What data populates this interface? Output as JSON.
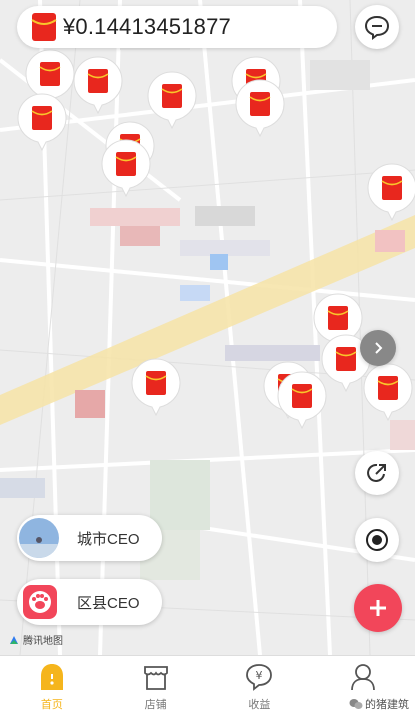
{
  "balance": {
    "currency": "¥",
    "amount": "0.14413451877",
    "text": "¥0.14413451877"
  },
  "buttons": {
    "message_icon": "chat-bubble-icon",
    "share_icon": "share-arrow-icon",
    "locate_icon": "locate-icon",
    "add_icon": "plus-icon",
    "arrow_icon": "chevron-right-icon"
  },
  "ceo": [
    {
      "label": "城市CEO",
      "icon": "city-avatar"
    },
    {
      "label": "区县CEO",
      "icon": "paw-avatar"
    }
  ],
  "map_provider": "腾讯地图",
  "tabs": [
    {
      "label": "首页",
      "icon": "home-icon",
      "active": true
    },
    {
      "label": "店铺",
      "icon": "shop-icon",
      "active": false
    },
    {
      "label": "收益",
      "icon": "yuan-icon",
      "active": false
    },
    {
      "label": "",
      "icon": "user-icon",
      "active": false
    }
  ],
  "watermark": "的猪建筑",
  "colors": {
    "accent": "#f5b51c",
    "red_packet": "#e8271e",
    "add_button": "#f2465a"
  }
}
